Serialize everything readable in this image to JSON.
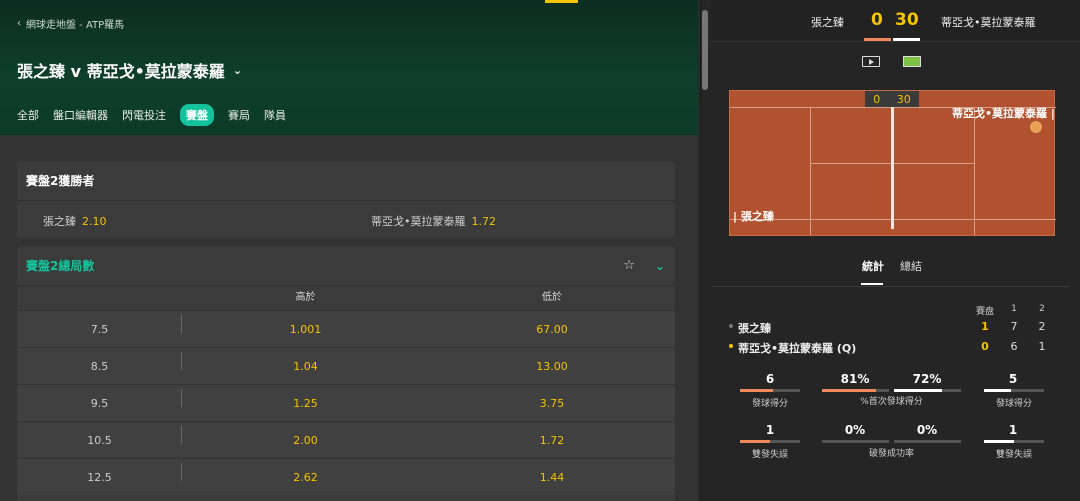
{
  "breadcrumb": {
    "back_icon": "chevron-left-icon",
    "text": "網球走地盤 - ATP羅馬"
  },
  "match": {
    "title": "張之臻 v 蒂亞戈•莫拉蒙泰羅",
    "dropdown_icon": "chevron-down-icon"
  },
  "tabs": [
    {
      "label": "全部"
    },
    {
      "label": "盤口編輯器"
    },
    {
      "label": "閃電投注"
    },
    {
      "label": "賽盤",
      "active": true
    },
    {
      "label": "賽局"
    },
    {
      "label": "隊員"
    }
  ],
  "market1": {
    "title": "賽盤2獲勝者",
    "p1": {
      "name": "張之臻",
      "odds": "2.10"
    },
    "p2": {
      "name": "蒂亞戈•莫拉蒙泰羅",
      "odds": "1.72"
    }
  },
  "market2": {
    "title": "賽盤2總局數",
    "fav_icon": "star-icon",
    "collapse_icon": "chevron-down-icon",
    "col_over": "高於",
    "col_under": "低於",
    "rows": [
      {
        "line": "7.5",
        "over": "1.001",
        "under": "67.00"
      },
      {
        "line": "8.5",
        "over": "1.04",
        "under": "13.00"
      },
      {
        "line": "9.5",
        "over": "1.25",
        "under": "3.75"
      },
      {
        "line": "10.5",
        "over": "2.00",
        "under": "1.72"
      },
      {
        "line": "12.5",
        "over": "2.62",
        "under": "1.44"
      }
    ]
  },
  "score": {
    "p1": "張之臻",
    "p2": "蒂亞戈•莫拉蒙泰羅",
    "s1": "0",
    "s2": "30",
    "video_icon": "play-video-icon",
    "court_icon": "court-view-icon"
  },
  "court": {
    "s1": "0",
    "s2": "30",
    "p1": "| 張之臻",
    "p2": "蒂亞戈•莫拉蒙泰羅 |"
  },
  "stat_tabs": {
    "stats": "統計",
    "summary": "總結"
  },
  "sets": {
    "header": "賽盘",
    "h1": "1",
    "h2": "2",
    "p1": {
      "name": "張之臻",
      "cur": "1",
      "s1": "7",
      "s2": "2"
    },
    "p2": {
      "name": "蒂亞戈•莫拉蒙泰羅 (Q)",
      "cur": "0",
      "s1": "6",
      "s2": "1"
    }
  },
  "stats": {
    "aces": {
      "p1": "6",
      "p2": "5",
      "label": "發球得分",
      "p1_frac": 0.55,
      "p2_frac": 0.45
    },
    "first_serve": {
      "p1": "81%",
      "p2": "72%",
      "label": "%首次發球得分",
      "p1_frac": 0.81,
      "p2_frac": 0.72
    },
    "double_faults": {
      "p1": "1",
      "p2": "1",
      "label": "雙發失誤",
      "p1_frac": 0.5,
      "p2_frac": 0.5
    },
    "break_points": {
      "p1": "0%",
      "p2": "0%",
      "label": "破發成功率",
      "p1_frac": 0,
      "p2_frac": 0
    }
  },
  "colors": {
    "accent": "#14c39b",
    "odds": "#f5c400",
    "p1": "#f08a5d",
    "p2": "#ffffff"
  }
}
